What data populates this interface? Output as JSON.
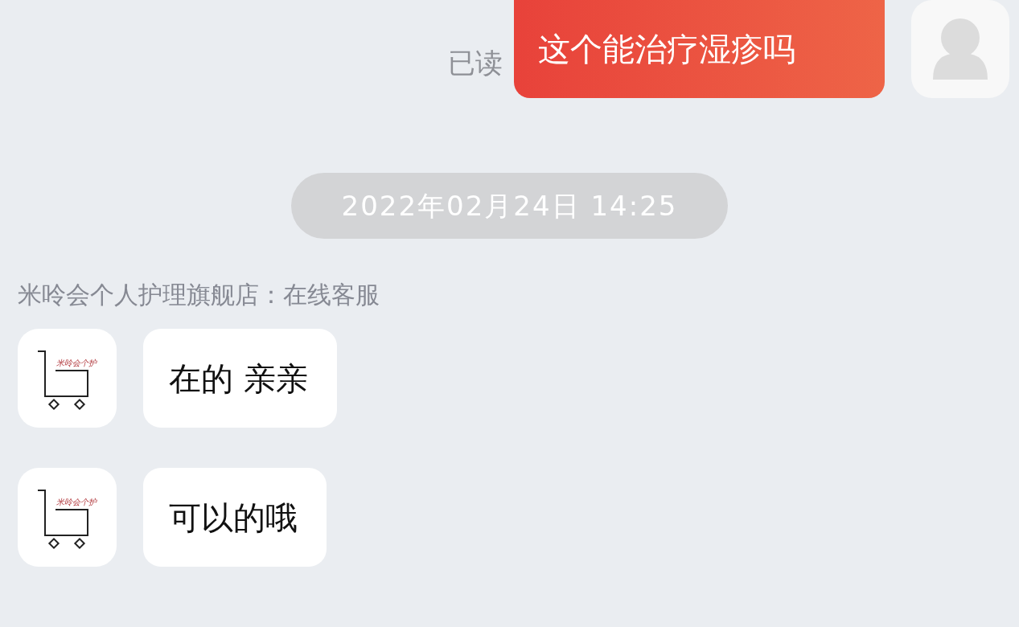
{
  "outgoing": {
    "read_status": "已读",
    "text": "这个能治疗湿疹吗"
  },
  "timestamp": "2022年02月24日 14:25",
  "sender_label": "米呤会个人护理旗舰店：在线客服",
  "messages": [
    {
      "logo_text": "米呤会个护",
      "text": "在的 亲亲"
    },
    {
      "logo_text": "米呤会个护",
      "text": "可以的哦"
    }
  ]
}
